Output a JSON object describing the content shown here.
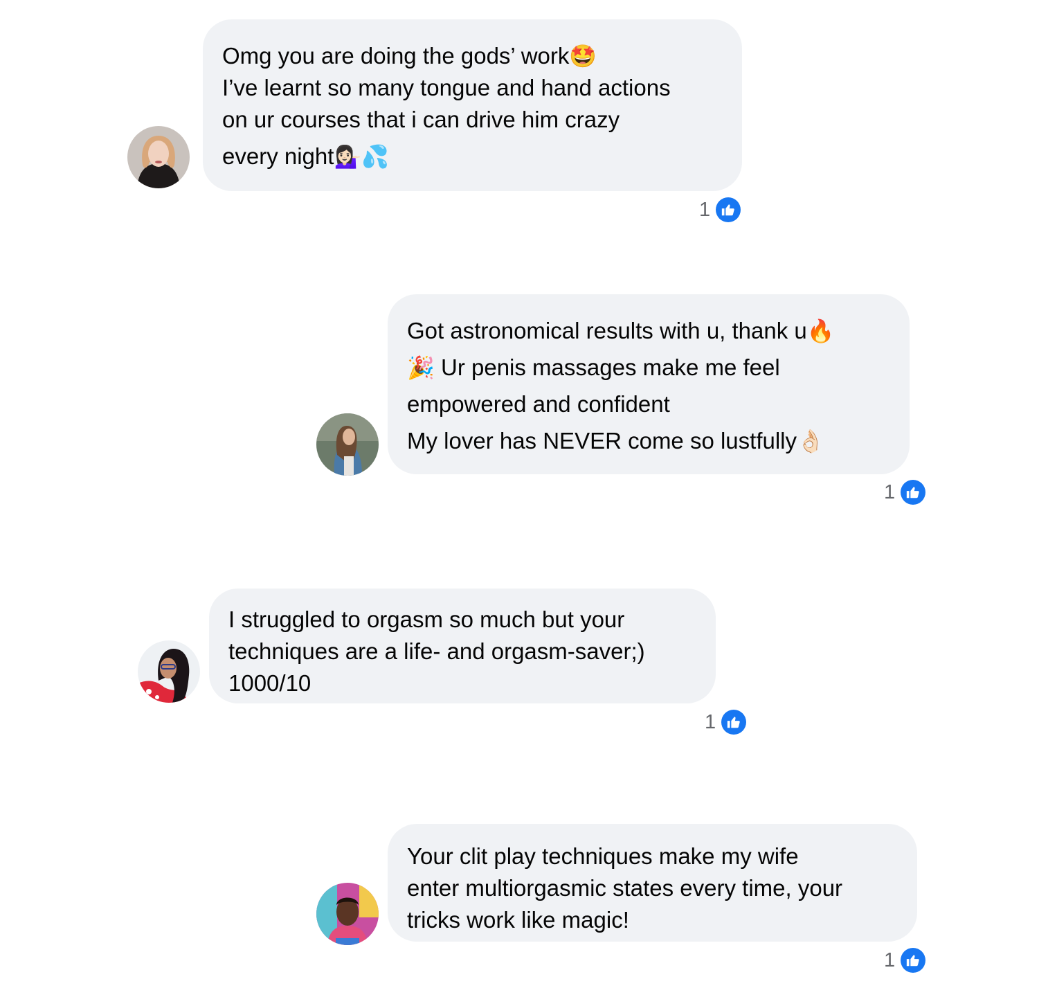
{
  "comments": [
    {
      "lines": [
        {
          "text": "Omg you are doing the gods’ work",
          "emoji": "🤩"
        },
        {
          "text": "I’ve learnt so many tongue and hand actions",
          "emoji": ""
        },
        {
          "text": "on ur courses that i can drive him crazy",
          "emoji": ""
        },
        {
          "text": "every night",
          "emoji": "💁🏻‍♀️💦"
        }
      ],
      "reaction_count": "1",
      "reaction_icon": "like-icon"
    },
    {
      "lines": [
        {
          "text": "Got astronomical results with u, thank u",
          "emoji": "🔥"
        },
        {
          "lead_emoji": "🎉",
          "text": " Ur penis massages make me feel"
        },
        {
          "text": "empowered and confident",
          "emoji": ""
        },
        {
          "text": "My lover has NEVER come so lustfully",
          "emoji": "👌🏻"
        }
      ],
      "reaction_count": "1",
      "reaction_icon": "like-icon"
    },
    {
      "lines": [
        {
          "text": " I struggled to orgasm so much but your"
        },
        {
          "text": "techniques are a life- and orgasm-saver;)"
        },
        {
          "text": "1000/10"
        }
      ],
      "reaction_count": "1",
      "reaction_icon": "like-icon"
    },
    {
      "lines": [
        {
          "text": "Your clit play techniques make my wife"
        },
        {
          "text": "enter multiorgasmic states every time, your"
        },
        {
          "text": "tricks work like magic!"
        }
      ],
      "reaction_count": "1",
      "reaction_icon": "like-icon"
    }
  ],
  "colors": {
    "bubble": "#f0f2f5",
    "like_blue": "#1877f2",
    "count_gray": "#65676b"
  }
}
